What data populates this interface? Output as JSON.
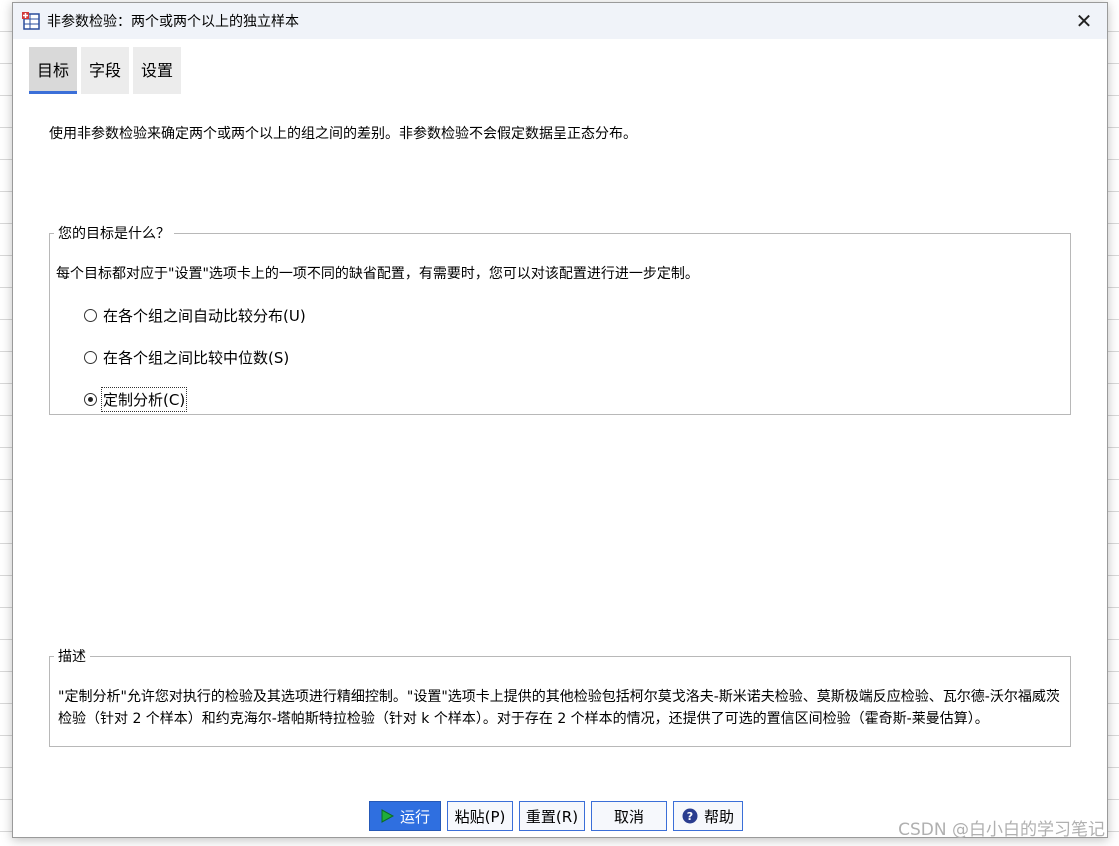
{
  "window": {
    "title": "非参数检验：两个或两个以上的独立样本",
    "close_glyph": "✕"
  },
  "tabs": [
    {
      "label": "目标",
      "active": true
    },
    {
      "label": "字段",
      "active": false
    },
    {
      "label": "设置",
      "active": false
    }
  ],
  "intro_text": "使用非参数检验来确定两个或两个以上的组之间的差别。非参数检验不会假定数据呈正态分布。",
  "goal": {
    "legend": "您的目标是什么？",
    "hint": "每个目标都对应于\"设置\"选项卡上的一项不同的缺省配置，有需要时，您可以对该配置进行进一步定制。",
    "options": [
      {
        "label": "在各个组之间自动比较分布(U)",
        "checked": false
      },
      {
        "label": "在各个组之间比较中位数(S)",
        "checked": false
      },
      {
        "label": "定制分析(C)",
        "checked": true
      }
    ]
  },
  "description": {
    "legend": "描述",
    "text": "\"定制分析\"允许您对执行的检验及其选项进行精细控制。\"设置\"选项卡上提供的其他检验包括柯尔莫戈洛夫-斯米诺夫检验、莫斯极端反应检验、瓦尔德-沃尔福威茨检验（针对 2 个样本）和约克海尔-塔帕斯特拉检验（针对 k 个样本）。对于存在 2 个样本的情况，还提供了可选的置信区间检验（霍奇斯-莱曼估算）。"
  },
  "buttons": {
    "run": "运行",
    "paste": "粘贴(P)",
    "reset": "重置(R)",
    "cancel": "取消",
    "help": "帮助"
  },
  "watermark": "CSDN @白小白的学习笔记",
  "colors": {
    "accent": "#3b6fd8",
    "run_icon": "#1fae3a",
    "help_icon": "#2a3d8f"
  }
}
